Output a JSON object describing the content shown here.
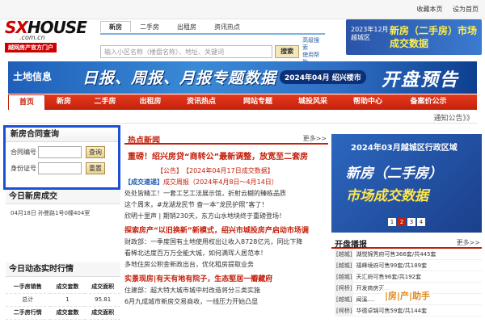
{
  "top_links": [
    "收藏本页",
    "设为首页"
  ],
  "logo": {
    "sx": "SX",
    "house": "HOUSE",
    "domain": ".com.cn",
    "slogan": "越网房产官方门户"
  },
  "search": {
    "tabs": [
      "新房",
      "二手房",
      "出租房",
      "资讯热点"
    ],
    "active_tab": 0,
    "placeholder": "输入小区名称（楼盘名称）、地址、关键词",
    "button": "搜索",
    "side_link_1": "高级搜索",
    "side_link_2": "使用帮助"
  },
  "top_ad": {
    "year": "2023年12月",
    "city": "越城区",
    "main1": "新房（二手房）市场",
    "main2": "成交数据"
  },
  "banner": {
    "left": "土地信息",
    "main": "日报、周报、月报专题数据",
    "date": "2024年04月 绍兴楼市",
    "right": "开盘预告"
  },
  "nav": [
    "首页",
    "新房",
    "二手房",
    "出租房",
    "资讯热点",
    "网站专题",
    "城投风采",
    "帮助中心",
    "备案价公示"
  ],
  "nav_active": 0,
  "notice": "通知公告》》",
  "contract_query": {
    "title": "新房合同查询",
    "field1": "合同编号",
    "field2": "身份证号",
    "btn1": "查询",
    "btn2": "重置"
  },
  "today_deals": {
    "title": "今日新房成交",
    "item": "04月18日 孙曼路1号0幢404室"
  },
  "today_stats": {
    "title": "今日动态实时行情",
    "header": [
      "一手房销售",
      "成交套数",
      "成交面积"
    ],
    "row": [
      "总计",
      "1",
      "95.81"
    ],
    "header2": [
      "二手房行情",
      "成交套数",
      "成交面积"
    ]
  },
  "news": {
    "title": "热点新闻",
    "more": "更多>>",
    "headline": "重磅！绍兴房贷“商转公”最新调整，放宽至二套房",
    "subline": "【公告】　【2024年04月17日成交数据】",
    "week_tag": "【成交速递】",
    "week_title": "成交周报（2024年4月8日～4月14日）",
    "l1": "处处皆精工！一套工艺工法展示馆，折射云樾的臻栋品质",
    "l2": "这个周末，#龙湖龙民节 奋一本“龙民护照”客了！",
    "l3": "欣明十里声 | 期销230天，东方山水地块终于重磅登场！",
    "h2": "探索房产“以旧换新”新模式，绍兴市城投房产启动市场调",
    "l4": "财政部：一季度国有土地使用权出让收入8728亿元，同比下降",
    "l5": "看稀北达度百万万全能大城，如何满珲人居范本！",
    "l6": "多地住房公积金新政出台，优化租房提取业务",
    "h3": "实景现房|有天有地有院子，生态堅居一瓣藏府",
    "l7": "住建部：超大特大城市城中村改造将分三类实施",
    "l8": "6月九成城市新房交易商收，一线压力开始凸显"
  },
  "right_ad": {
    "year": "2024年03月越城区行政区域",
    "m1": "新房（二手房）",
    "m2": "市场成交数据",
    "pages": [
      "1",
      "2",
      "3",
      "4"
    ],
    "active_page": 1
  },
  "kaipan": {
    "title": "开盘播报",
    "more": "更多>>",
    "items": [
      {
        "d": "[越城]",
        "t": "湖悦锦秀府可售366套/共445套"
      },
      {
        "d": "[越城]",
        "t": "禧峰境府可售99套/共189套"
      },
      {
        "d": "[越城]",
        "t": "天汇府可售96套/共192套"
      },
      {
        "d": "[柯桥]",
        "t": "开发商房天..."
      },
      {
        "d": "[越城]",
        "t": "闻溪...."
      },
      {
        "d": "[柯桥]",
        "t": "华德卓锦可售59套/共144套"
      }
    ]
  },
  "watermark": "|房|产|助手"
}
